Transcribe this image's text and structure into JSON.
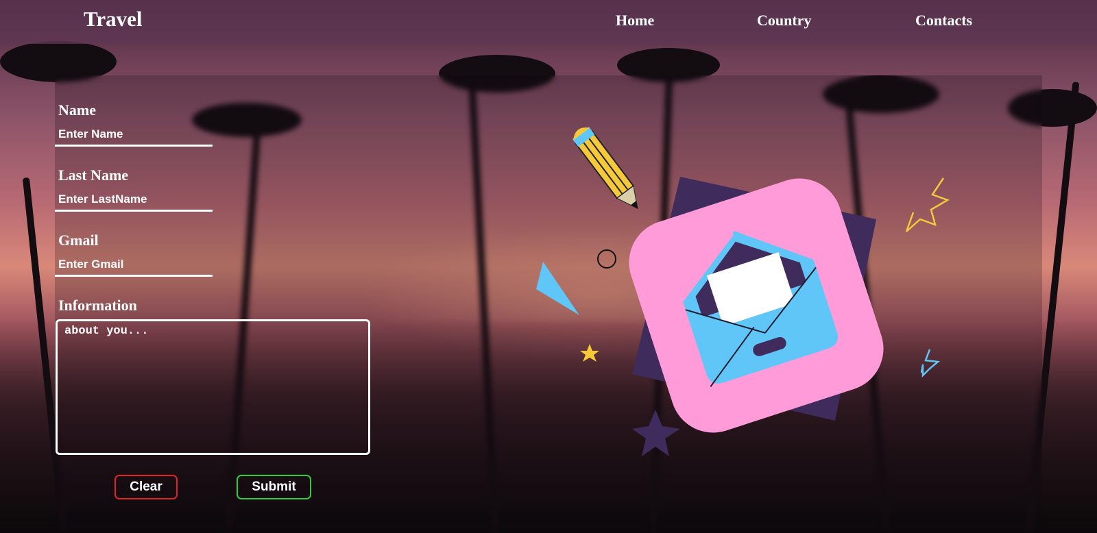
{
  "app": {
    "brand": "Travel"
  },
  "nav": {
    "links": [
      "Home",
      "Country",
      "Contacts"
    ]
  },
  "form": {
    "name_label": "Name",
    "name_placeholder": "Enter Name",
    "lastname_label": "Last Name",
    "lastname_placeholder": "Enter LastName",
    "gmail_label": "Gmail",
    "gmail_placeholder": "Enter Gmail",
    "info_label": "Information",
    "info_placeholder": "about you...",
    "clear_label": "Clear",
    "submit_label": "Submit"
  },
  "colors": {
    "clear_border": "#e0242a",
    "submit_border": "#2ecf3a",
    "card_pink": "#ff9bd9",
    "card_shadow": "#3f2c5c",
    "envelope_blue": "#5fc6f7"
  },
  "icons": {
    "illustration": "mail-envelope-illustration",
    "pencil": "pencil-icon",
    "stars": "star-icon"
  }
}
